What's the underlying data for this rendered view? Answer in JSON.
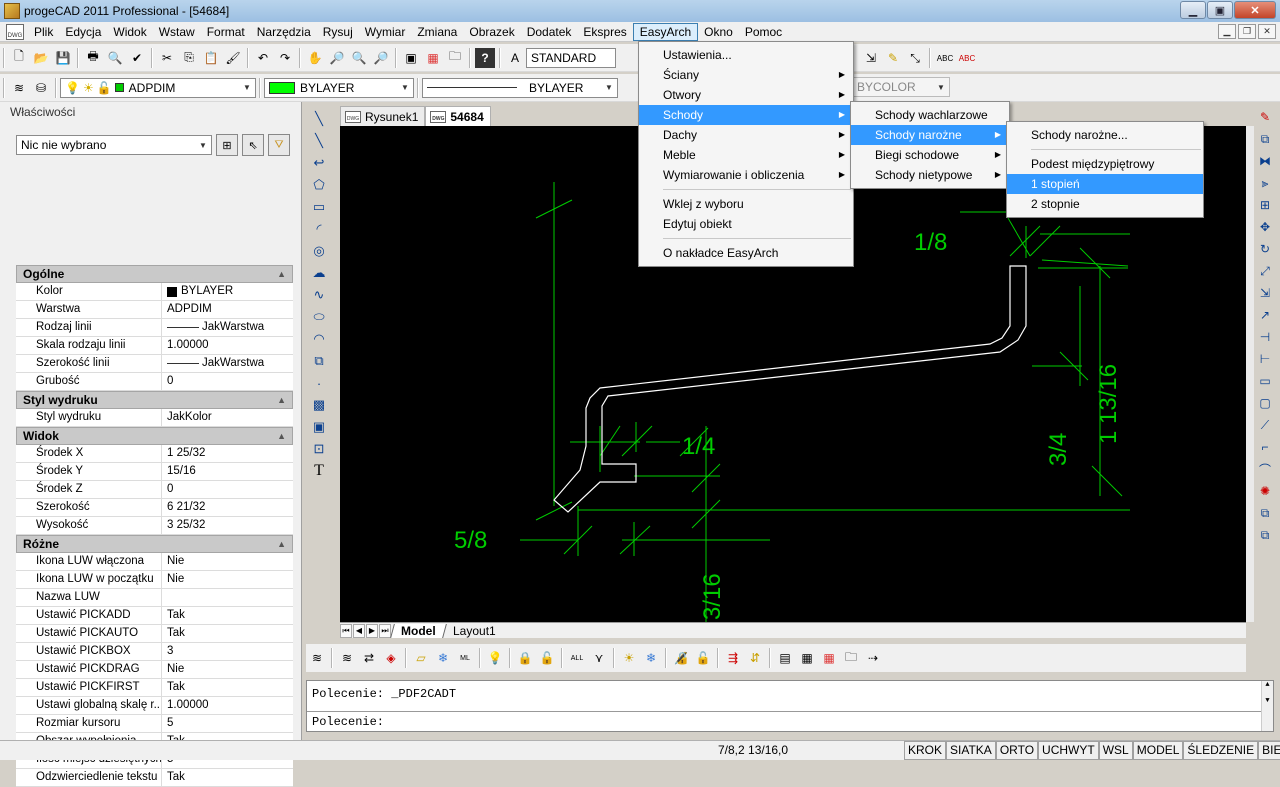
{
  "window": {
    "title": "progeCAD 2011 Professional - [54684]",
    "minimize": "▁",
    "maximize": "▣",
    "close": "✕"
  },
  "menubar": {
    "items": [
      "Plik",
      "Edycja",
      "Widok",
      "Wstaw",
      "Format",
      "Narzędzia",
      "Rysuj",
      "Wymiar",
      "Zmiana",
      "Obrazek",
      "Dodatek",
      "Ekspres",
      "EasyArch",
      "Okno",
      "Pomoc"
    ],
    "active": "EasyArch",
    "doc_icon": "DWG"
  },
  "toolbar1": {
    "text_style": "STANDARD"
  },
  "toolbar2": {
    "layer": "ADPDIM",
    "color": "BYLAYER",
    "color_swatch": "#00ff00",
    "linetype": "BYLAYER",
    "plotstyle": "BYCOLOR"
  },
  "properties": {
    "header": "Właściwości",
    "selection": "Nic nie wybrano",
    "sections": [
      {
        "title": "Ogólne",
        "rows": [
          {
            "k": "Kolor",
            "v": "BYLAYER",
            "glyph": "swatch"
          },
          {
            "k": "Warstwa",
            "v": "ADPDIM"
          },
          {
            "k": "Rodzaj linii",
            "v": "JakWarstwa",
            "glyph": "line"
          },
          {
            "k": "Skala rodzaju linii",
            "v": "1.00000"
          },
          {
            "k": "Szerokość linii",
            "v": "JakWarstwa",
            "glyph": "line"
          },
          {
            "k": "Grubość",
            "v": "0"
          }
        ]
      },
      {
        "title": "Styl wydruku",
        "rows": [
          {
            "k": "Styl wydruku",
            "v": "JakKolor"
          }
        ]
      },
      {
        "title": "Widok",
        "rows": [
          {
            "k": "Środek X",
            "v": "1 25/32"
          },
          {
            "k": "Środek Y",
            "v": "15/16"
          },
          {
            "k": "Środek Z",
            "v": "0"
          },
          {
            "k": "Szerokość",
            "v": "6 21/32"
          },
          {
            "k": "Wysokość",
            "v": "3 25/32"
          }
        ]
      },
      {
        "title": "Różne",
        "rows": [
          {
            "k": "Ikona LUW włączona",
            "v": "Nie"
          },
          {
            "k": "Ikona LUW w początku",
            "v": "Nie"
          },
          {
            "k": "Nazwa LUW",
            "v": ""
          },
          {
            "k": "Ustawić PICKADD",
            "v": "Tak"
          },
          {
            "k": "Ustawić PICKAUTO",
            "v": "Tak"
          },
          {
            "k": "Ustawić PICKBOX",
            "v": "3"
          },
          {
            "k": "Ustawić PICKDRAG",
            "v": "Nie"
          },
          {
            "k": "Ustawić PICKFIRST",
            "v": "Tak"
          },
          {
            "k": "Ustawi globalną skalę r...",
            "v": "1.00000"
          },
          {
            "k": "Rozmiar kursoru",
            "v": "5"
          },
          {
            "k": "Obszar wypełnienia",
            "v": "Tak"
          },
          {
            "k": "Ilość miejsc dziesiętnych",
            "v": "5"
          },
          {
            "k": "Odzwierciedlenie tekstu",
            "v": "Tak"
          }
        ]
      }
    ]
  },
  "doc_tabs": [
    {
      "label": "Rysunek1",
      "icon": "DWG"
    },
    {
      "label": "54684",
      "icon": "DWG",
      "active": true
    }
  ],
  "drawing": {
    "dims": [
      "1/8",
      "1 13/16",
      "3/4",
      "1/4",
      "5/8",
      "3/16"
    ],
    "line_color": "#00cc00"
  },
  "layout_tabs": [
    "Model",
    "Layout1"
  ],
  "command": {
    "history": "Polecenie: _PDF2CADT",
    "prompt": "Polecenie:"
  },
  "status": {
    "coords": "7/8,2 13/16,0",
    "toggles": [
      "KROK",
      "SIATKA",
      "ORTO",
      "UCHWYT",
      "WSL",
      "MODEL",
      "ŚLEDZENIE",
      "BIEGUN"
    ]
  },
  "easyarch_menu": {
    "items": [
      {
        "label": "Ustawienia...",
        "sub": false
      },
      {
        "label": "Ściany",
        "sub": true
      },
      {
        "label": "Otwory",
        "sub": true
      },
      {
        "label": "Schody",
        "sub": true,
        "hl": true
      },
      {
        "label": "Dachy",
        "sub": true
      },
      {
        "label": "Meble",
        "sub": true
      },
      {
        "label": "Wymiarowanie i obliczenia",
        "sub": true
      }
    ],
    "group2": [
      "Wklej z wyboru",
      "Edytuj obiekt"
    ],
    "group3": [
      "O nakładce EasyArch"
    ]
  },
  "schody_menu": {
    "items": [
      {
        "label": "Schody wachlarzowe",
        "sub": false
      },
      {
        "label": "Schody narożne",
        "sub": true,
        "hl": true
      },
      {
        "label": "Biegi schodowe",
        "sub": true
      },
      {
        "label": "Schody nietypowe",
        "sub": true
      }
    ]
  },
  "narozne_menu": {
    "top": "Schody narożne...",
    "items": [
      {
        "label": "Podest międzypiętrowy"
      },
      {
        "label": "1 stopień",
        "hl": true
      },
      {
        "label": "2 stopnie"
      }
    ]
  },
  "submenu_arrow": "▶"
}
